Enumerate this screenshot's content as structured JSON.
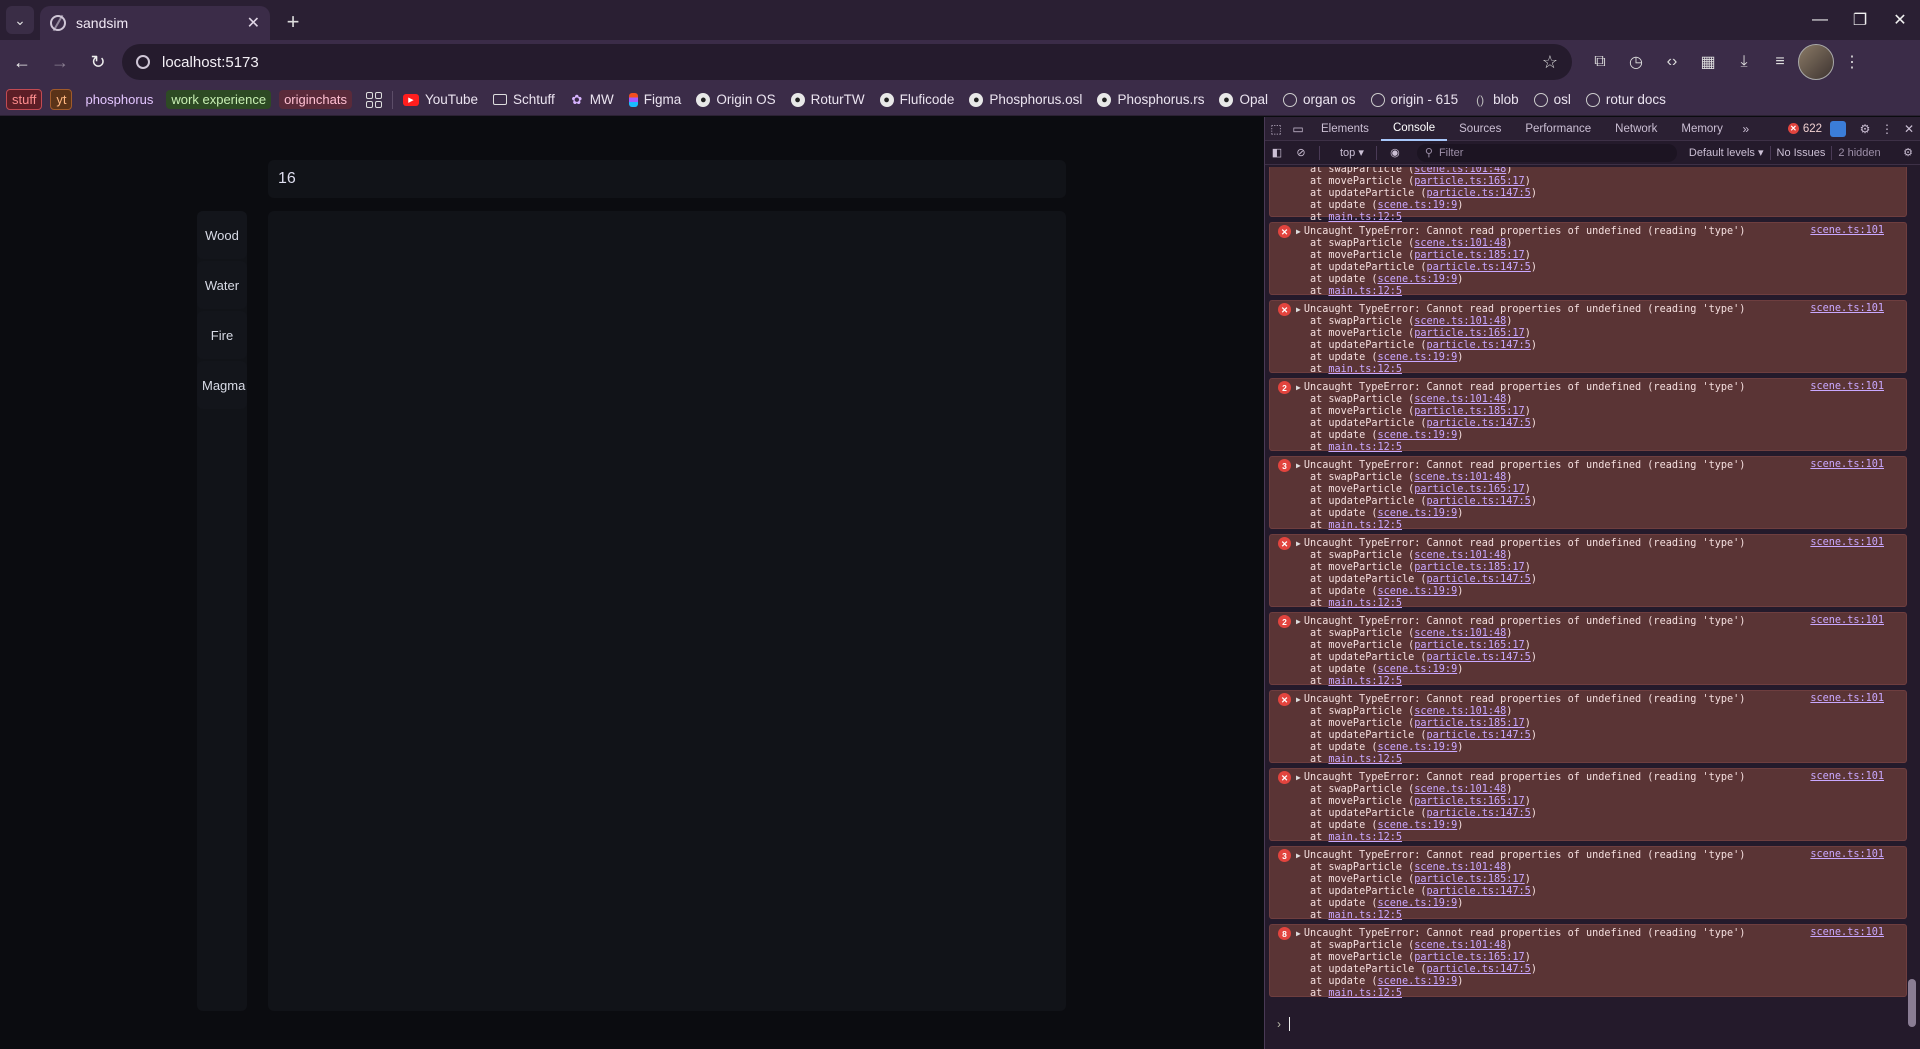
{
  "browser": {
    "tab_title": "sandsim",
    "url": "localhost:5173",
    "bookmark_chips": [
      {
        "label": "stuff",
        "style": "red"
      },
      {
        "label": "yt",
        "style": "orange"
      },
      {
        "label": "phosphorus",
        "style": "purple"
      },
      {
        "label": "work experience",
        "style": "green"
      },
      {
        "label": "originchats",
        "style": "pink"
      }
    ],
    "bookmarks": [
      {
        "label": "YouTube",
        "icon": "youtube-icon"
      },
      {
        "label": "Schtuff",
        "icon": "folder-icon"
      },
      {
        "label": "MW",
        "icon": "mw-icon"
      },
      {
        "label": "Figma",
        "icon": "figma-icon"
      },
      {
        "label": "Origin OS",
        "icon": "github-icon"
      },
      {
        "label": "RoturTW",
        "icon": "github-icon"
      },
      {
        "label": "Fluficode",
        "icon": "github-icon"
      },
      {
        "label": "Phosphorus.osl",
        "icon": "github-icon"
      },
      {
        "label": "Phosphorus.rs",
        "icon": "github-icon"
      },
      {
        "label": "Opal",
        "icon": "github-icon"
      },
      {
        "label": "organ os",
        "icon": "orb-icon"
      },
      {
        "label": "origin - 615",
        "icon": "orb-icon"
      },
      {
        "label": "blob",
        "icon": "blob-icon"
      },
      {
        "label": "osl",
        "icon": "orb-icon"
      },
      {
        "label": "rotur docs",
        "icon": "gear-icon"
      }
    ]
  },
  "app": {
    "counter_value": "16",
    "elements": [
      "Wood",
      "Water",
      "Fire",
      "Magma"
    ]
  },
  "devtools": {
    "tabs": [
      "Elements",
      "Console",
      "Sources",
      "Performance",
      "Network",
      "Memory"
    ],
    "active_tab": "Console",
    "error_count": "622",
    "context": "top",
    "filter_placeholder": "Filter",
    "levels": "Default levels",
    "issues": "No Issues",
    "hidden": "2 hidden",
    "error_message": "Uncaught TypeError: Cannot read properties of undefined (reading 'type')",
    "source_link": "scene.ts:101",
    "top_partial_frames": [
      {
        "fn": "at swapParticle (",
        "loc": "scene.ts:101:48"
      },
      {
        "fn": "at moveParticle (",
        "loc": "particle.ts:165:17"
      },
      {
        "fn": "at updateParticle (",
        "loc": "particle.ts:147:5"
      },
      {
        "fn": "at update (",
        "loc": "scene.ts:19:9"
      },
      {
        "fn": "at ",
        "loc": "main.ts:12:5"
      }
    ],
    "entries": [
      {
        "badge": "x",
        "frames": [
          {
            "fn": "at swapParticle (",
            "loc": "scene.ts:101:48"
          },
          {
            "fn": "at moveParticle (",
            "loc": "particle.ts:185:17"
          },
          {
            "fn": "at updateParticle (",
            "loc": "particle.ts:147:5"
          },
          {
            "fn": "at update (",
            "loc": "scene.ts:19:9"
          },
          {
            "fn": "at ",
            "loc": "main.ts:12:5"
          }
        ]
      },
      {
        "badge": "x",
        "frames": [
          {
            "fn": "at swapParticle (",
            "loc": "scene.ts:101:48"
          },
          {
            "fn": "at moveParticle (",
            "loc": "particle.ts:165:17"
          },
          {
            "fn": "at updateParticle (",
            "loc": "particle.ts:147:5"
          },
          {
            "fn": "at update (",
            "loc": "scene.ts:19:9"
          },
          {
            "fn": "at ",
            "loc": "main.ts:12:5"
          }
        ]
      },
      {
        "badge": "2",
        "frames": [
          {
            "fn": "at swapParticle (",
            "loc": "scene.ts:101:48"
          },
          {
            "fn": "at moveParticle (",
            "loc": "particle.ts:185:17"
          },
          {
            "fn": "at updateParticle (",
            "loc": "particle.ts:147:5"
          },
          {
            "fn": "at update (",
            "loc": "scene.ts:19:9"
          },
          {
            "fn": "at ",
            "loc": "main.ts:12:5"
          }
        ]
      },
      {
        "badge": "3",
        "frames": [
          {
            "fn": "at swapParticle (",
            "loc": "scene.ts:101:48"
          },
          {
            "fn": "at moveParticle (",
            "loc": "particle.ts:165:17"
          },
          {
            "fn": "at updateParticle (",
            "loc": "particle.ts:147:5"
          },
          {
            "fn": "at update (",
            "loc": "scene.ts:19:9"
          },
          {
            "fn": "at ",
            "loc": "main.ts:12:5"
          }
        ]
      },
      {
        "badge": "x",
        "frames": [
          {
            "fn": "at swapParticle (",
            "loc": "scene.ts:101:48"
          },
          {
            "fn": "at moveParticle (",
            "loc": "particle.ts:185:17"
          },
          {
            "fn": "at updateParticle (",
            "loc": "particle.ts:147:5"
          },
          {
            "fn": "at update (",
            "loc": "scene.ts:19:9"
          },
          {
            "fn": "at ",
            "loc": "main.ts:12:5"
          }
        ]
      },
      {
        "badge": "2",
        "frames": [
          {
            "fn": "at swapParticle (",
            "loc": "scene.ts:101:48"
          },
          {
            "fn": "at moveParticle (",
            "loc": "particle.ts:165:17"
          },
          {
            "fn": "at updateParticle (",
            "loc": "particle.ts:147:5"
          },
          {
            "fn": "at update (",
            "loc": "scene.ts:19:9"
          },
          {
            "fn": "at ",
            "loc": "main.ts:12:5"
          }
        ]
      },
      {
        "badge": "x",
        "frames": [
          {
            "fn": "at swapParticle (",
            "loc": "scene.ts:101:48"
          },
          {
            "fn": "at moveParticle (",
            "loc": "particle.ts:185:17"
          },
          {
            "fn": "at updateParticle (",
            "loc": "particle.ts:147:5"
          },
          {
            "fn": "at update (",
            "loc": "scene.ts:19:9"
          },
          {
            "fn": "at ",
            "loc": "main.ts:12:5"
          }
        ]
      },
      {
        "badge": "x",
        "frames": [
          {
            "fn": "at swapParticle (",
            "loc": "scene.ts:101:48"
          },
          {
            "fn": "at moveParticle (",
            "loc": "particle.ts:165:17"
          },
          {
            "fn": "at updateParticle (",
            "loc": "particle.ts:147:5"
          },
          {
            "fn": "at update (",
            "loc": "scene.ts:19:9"
          },
          {
            "fn": "at ",
            "loc": "main.ts:12:5"
          }
        ]
      },
      {
        "badge": "3",
        "frames": [
          {
            "fn": "at swapParticle (",
            "loc": "scene.ts:101:48"
          },
          {
            "fn": "at moveParticle (",
            "loc": "particle.ts:185:17"
          },
          {
            "fn": "at updateParticle (",
            "loc": "particle.ts:147:5"
          },
          {
            "fn": "at update (",
            "loc": "scene.ts:19:9"
          },
          {
            "fn": "at ",
            "loc": "main.ts:12:5"
          }
        ]
      },
      {
        "badge": "8",
        "frames": [
          {
            "fn": "at swapParticle (",
            "loc": "scene.ts:101:48"
          },
          {
            "fn": "at moveParticle (",
            "loc": "particle.ts:165:17"
          },
          {
            "fn": "at updateParticle (",
            "loc": "particle.ts:147:5"
          },
          {
            "fn": "at update (",
            "loc": "scene.ts:19:9"
          },
          {
            "fn": "at ",
            "loc": "main.ts:12:5"
          }
        ]
      }
    ]
  }
}
